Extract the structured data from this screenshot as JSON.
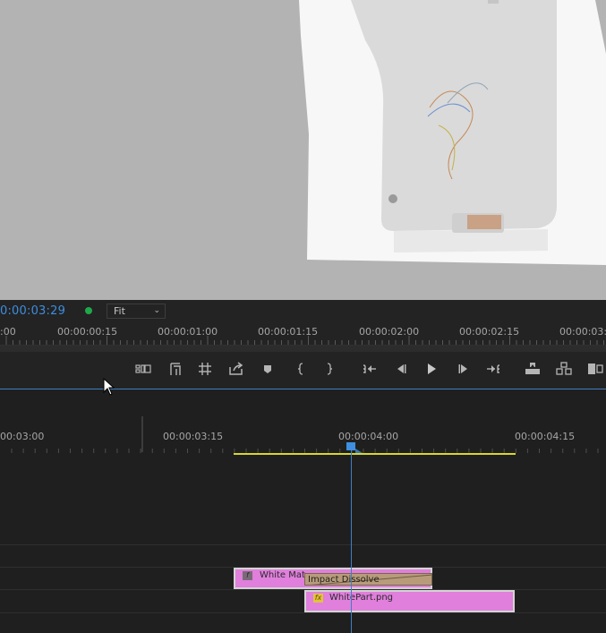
{
  "program_monitor": {
    "timecode": "0:00:03:29",
    "zoom": "Fit",
    "ruler_labels": [
      ":00",
      "00:00:00:15",
      "00:00:01:00",
      "00:00:01:15",
      "00:00:02:00",
      "00:00:02:15",
      "00:00:03:0"
    ]
  },
  "transport_controls": [
    {
      "name": "export-frame-button-group",
      "icon": "safe-margins-icon"
    },
    {
      "name": "mark-in-point-button",
      "icon": "film-frame-icon"
    },
    {
      "name": "grid-button",
      "icon": "hash-icon"
    },
    {
      "name": "export-frame-button",
      "icon": "export-frame-icon"
    },
    {
      "name": "add-marker-button",
      "icon": "marker-icon"
    },
    {
      "name": "mark-in-button",
      "icon": "brace-open-icon"
    },
    {
      "name": "mark-out-button",
      "icon": "brace-close-icon"
    },
    {
      "name": "go-to-in-button",
      "icon": "go-to-in-icon"
    },
    {
      "name": "step-back-button",
      "icon": "step-back-icon"
    },
    {
      "name": "play-button",
      "icon": "play-icon"
    },
    {
      "name": "step-forward-button",
      "icon": "step-forward-icon"
    },
    {
      "name": "go-to-out-button",
      "icon": "go-to-out-icon"
    },
    {
      "name": "lift-button",
      "icon": "lift-icon"
    },
    {
      "name": "extract-button",
      "icon": "extract-icon"
    },
    {
      "name": "compare-view-button",
      "icon": "compare-icon"
    }
  ],
  "timeline": {
    "ruler_labels": [
      "00:03:00",
      "00:00:03:15",
      "00:00:04:00",
      "00:00:04:15"
    ],
    "clips": {
      "white_mat": "White Mat",
      "transition": "Impact Dissolve",
      "white_part": "WhitePart.png",
      "fx_badge": "fx"
    }
  },
  "colors": {
    "timecode_blue": "#3d8ee0",
    "clip_pink": "#e07fdc",
    "work_area_yellow": "#d8d62d",
    "playhead_blue": "#3e8fe0"
  }
}
